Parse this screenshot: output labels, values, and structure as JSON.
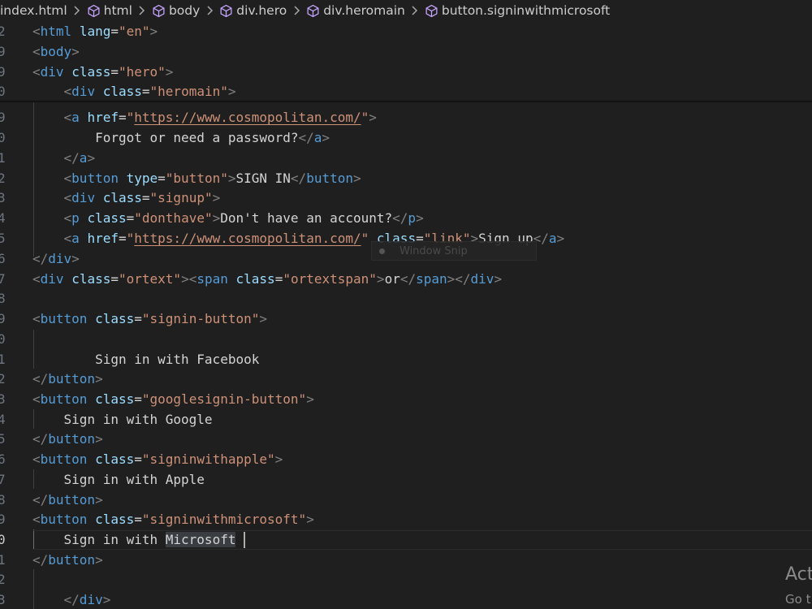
{
  "breadcrumb": {
    "file": "index.html",
    "items": [
      "html",
      "body",
      "div.hero",
      "div.heromain",
      "button.signinwithmicrosoft"
    ]
  },
  "gutter": {
    "line_numbers": [
      "2",
      "9",
      "9",
      "0",
      "9",
      "0",
      "1",
      "2",
      "3",
      "4",
      "5",
      "6",
      "7",
      "8",
      "9",
      "0",
      "1",
      "2",
      "3",
      "4",
      "5",
      "6",
      "7",
      "8",
      "9",
      "0",
      "1",
      "2",
      "3"
    ],
    "active_line_number": "0"
  },
  "code": {
    "line_1": {
      "p1": "<",
      "tag": "html",
      "attr": "lang",
      "eq": "=",
      "val": "\"en\"",
      "p2": ">"
    },
    "line_2": {
      "p1": "<",
      "tag": "body",
      "p2": ">"
    },
    "line_3": {
      "p1": "<",
      "tag": "div",
      "attr": "class",
      "eq": "=",
      "val": "\"hero\"",
      "p2": ">"
    },
    "line_4": {
      "p1": "<",
      "tag": "div",
      "attr": "class",
      "eq": "=",
      "val": "\"heromain\"",
      "p2": ">"
    },
    "line_5": {
      "p1": "<",
      "tag": "a",
      "attr": "href",
      "eq": "=",
      "q1": "\"",
      "url": "https://www.cosmopolitan.com/",
      "q2": "\"",
      "p2": ">"
    },
    "line_6": {
      "text": "Forgot or need a password?",
      "p1": "</",
      "tag": "a",
      "p2": ">"
    },
    "line_7": {
      "p1": "</",
      "tag": "a",
      "p2": ">"
    },
    "line_8": {
      "p1": "<",
      "tag": "button",
      "attr": "type",
      "eq": "=",
      "val": "\"button\"",
      "p2": ">",
      "text": "SIGN IN",
      "p3": "</",
      "tag2": "button",
      "p4": ">"
    },
    "line_9": {
      "p1": "<",
      "tag": "div",
      "attr": "class",
      "eq": "=",
      "val": "\"signup\"",
      "p2": ">"
    },
    "line_10": {
      "p1": "<",
      "tag": "p",
      "attr": "class",
      "eq": "=",
      "val": "\"donthave\"",
      "p2": ">",
      "text": "Don't have an account?",
      "p3": "</",
      "tag2": "p",
      "p4": ">"
    },
    "line_11": {
      "p1": "<",
      "tag": "a",
      "attr": "href",
      "eq": "=",
      "q1": "\"",
      "url": "https://www.cosmopolitan.com/",
      "q2": "\"",
      "attr2": "class",
      "eq2": "=",
      "val2": "\"link\"",
      "p2": ">",
      "text": "Sign up",
      "p3": "</",
      "tag2": "a",
      "p4": ">"
    },
    "line_12": {
      "p1": "</",
      "tag": "div",
      "p2": ">"
    },
    "line_13": {
      "p1": "<",
      "tag": "div",
      "attr": "class",
      "eq": "=",
      "val": "\"ortext\"",
      "p2": ">",
      "p3": "<",
      "tag2": "span",
      "attr2": "class",
      "eq2": "=",
      "val2": "\"ortextspan\"",
      "p4": ">",
      "text": "or",
      "p5": "</",
      "tag3": "span",
      "p6": "></",
      "tag4": "div",
      "p7": ">"
    },
    "line_15": {
      "p1": "<",
      "tag": "button",
      "attr": "class",
      "eq": "=",
      "val": "\"signin-button\"",
      "p2": ">"
    },
    "line_17": {
      "text": "Sign in with Facebook"
    },
    "line_18": {
      "p1": "</",
      "tag": "button",
      "p2": ">"
    },
    "line_19": {
      "p1": "<",
      "tag": "button",
      "attr": "class",
      "eq": "=",
      "val": "\"googlesignin-button\"",
      "p2": ">"
    },
    "line_20": {
      "text": "Sign in with Google"
    },
    "line_21": {
      "p1": "</",
      "tag": "button",
      "p2": ">"
    },
    "line_22": {
      "p1": "<",
      "tag": "button",
      "attr": "class",
      "eq": "=",
      "val": "\"signinwithapple\"",
      "p2": ">"
    },
    "line_23": {
      "text": "Sign in with Apple"
    },
    "line_24": {
      "p1": "</",
      "tag": "button",
      "p2": ">"
    },
    "line_25": {
      "p1": "<",
      "tag": "button",
      "attr": "class",
      "eq": "=",
      "val": "\"signinwithmicrosoft\"",
      "p2": ">"
    },
    "line_26": {
      "text": "Sign in with ",
      "selected": "Microsoft"
    },
    "line_27": {
      "p1": "</",
      "tag": "button",
      "p2": ">"
    },
    "line_29": {
      "p1": "</",
      "tag": "div",
      "p2": ">"
    }
  },
  "overlays": {
    "snip_label": "Window Snip",
    "activate_title": "Act",
    "activate_sub": "Go t"
  },
  "icons": {
    "breadcrumb_separator": "chevron-right-icon",
    "breadcrumb_element": "cube-icon"
  },
  "colors": {
    "background": "#1f1f1f",
    "tag": "#569cd6",
    "attribute": "#9cdcfe",
    "string": "#ce9178",
    "text": "#d4d4d4",
    "punctuation": "#808080"
  }
}
